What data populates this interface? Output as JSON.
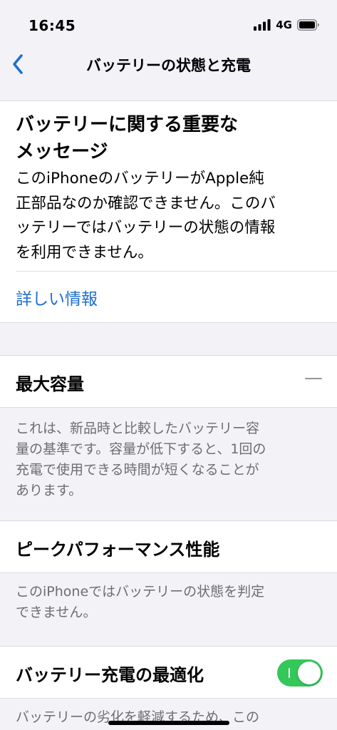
{
  "status_bar": {
    "time": "16:45",
    "network": "4G",
    "icons": [
      "signal-icon",
      "battery-icon"
    ]
  },
  "nav": {
    "back_icon": "chevron-left-icon",
    "title": "バッテリーの状態と充電"
  },
  "important_message": {
    "title_line1": "バッテリーに関する重要な",
    "title_line2": "メッセージ",
    "body_line1": "このiPhoneのバッテリーがApple純",
    "body_line2": "正部品なのか確認できません。このバ",
    "body_line3": "ッテリーではバッテリーの状態の情報",
    "body_line4": "を利用できません。",
    "link": "詳しい情報"
  },
  "max_capacity": {
    "label": "最大容量",
    "value": "—",
    "footnote_line1": "これは、新品時と比較したバッテリー容",
    "footnote_line2": "量の基準です。容量が低下すると、1回の",
    "footnote_line3": "充電で使用できる時間が短くなることが",
    "footnote_line4": "あります。"
  },
  "peak_performance": {
    "label": "ピークパフォーマンス性能",
    "footnote_line1": "このiPhoneではバッテリーの状態を判定",
    "footnote_line2": "できません。"
  },
  "optimized_charging": {
    "label": "バッテリー充電の最適化",
    "enabled": true,
    "footnote_partial": "バッテリーの劣化を軽減するため、この"
  },
  "colors": {
    "accent": "#1f6fce",
    "toggle_on": "#34c759",
    "background": "#f2f2f7"
  }
}
